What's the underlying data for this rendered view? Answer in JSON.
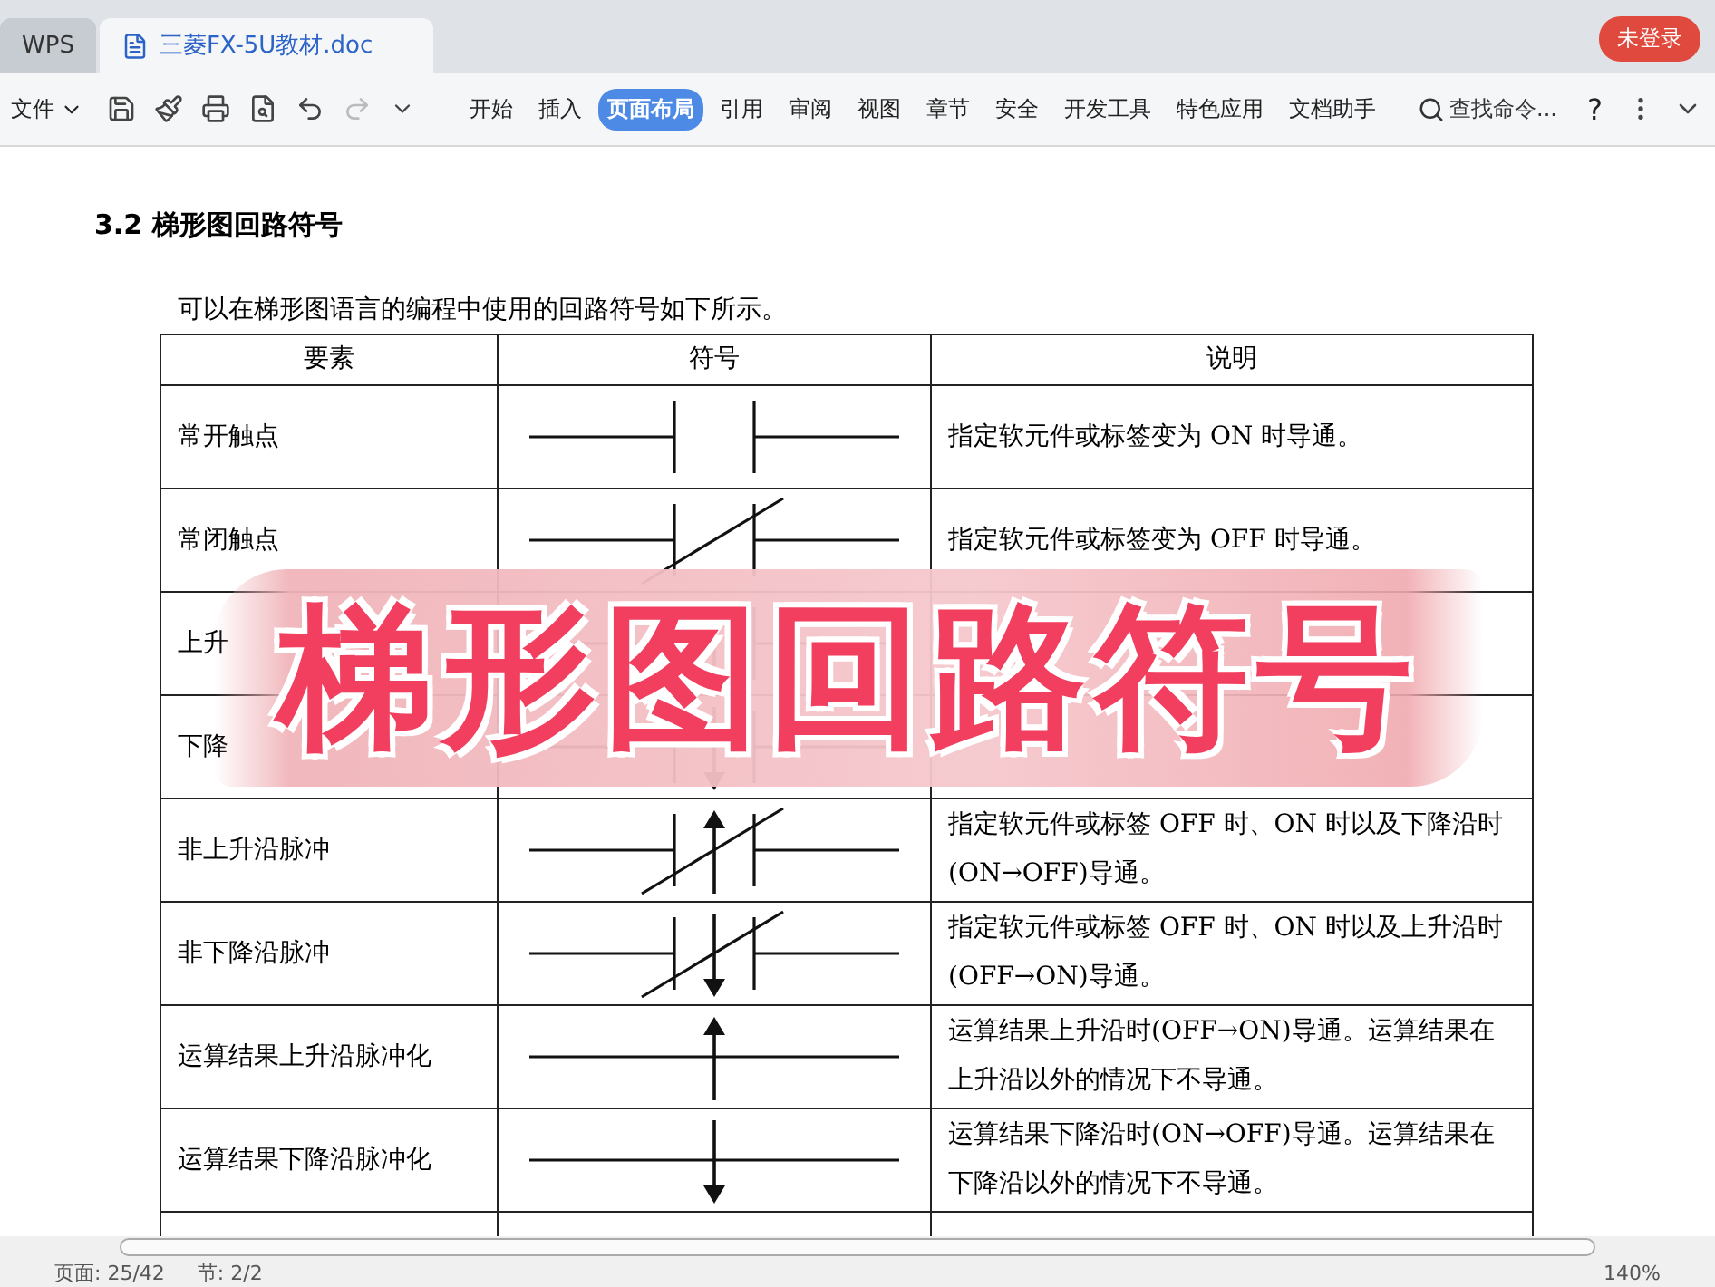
{
  "app_tabs": [
    {
      "label": "WPS",
      "selected": false
    },
    {
      "label": "三菱FX-5U教材.doc",
      "selected": true
    }
  ],
  "login_button": "未登录",
  "file_menu": "文件",
  "ribbon_tabs": [
    {
      "label": "开始",
      "selected": false
    },
    {
      "label": "插入",
      "selected": false
    },
    {
      "label": "页面布局",
      "selected": true
    },
    {
      "label": "引用",
      "selected": false
    },
    {
      "label": "审阅",
      "selected": false
    },
    {
      "label": "视图",
      "selected": false
    },
    {
      "label": "章节",
      "selected": false
    },
    {
      "label": "安全",
      "selected": false
    },
    {
      "label": "开发工具",
      "selected": false
    },
    {
      "label": "特色应用",
      "selected": false
    },
    {
      "label": "文档助手",
      "selected": false
    }
  ],
  "search": {
    "placeholder": "查找命令..."
  },
  "help": "?",
  "document": {
    "heading": "3.2  梯形图回路符号",
    "intro": "可以在梯形图语言的编程中使用的回路符号如下所示。",
    "table": {
      "columns": [
        "要素",
        "符号",
        "说明"
      ],
      "rows": [
        {
          "element": "常开触点",
          "kind": "no",
          "description": "指定软元件或标签变为 ON 时导通。"
        },
        {
          "element": "常闭触点",
          "kind": "nc",
          "description": "指定软元件或标签变为 OFF 时导通。"
        },
        {
          "element": "上升",
          "kind": "rise"
        },
        {
          "element": "下降",
          "kind": "fall"
        },
        {
          "element": "非上升沿脉冲",
          "kind": "not_rise",
          "description": "指定软元件或标签 OFF 时、ON 时以及下降沿时(ON→OFF)导通。"
        },
        {
          "element": "非下降沿脉冲",
          "kind": "not_fall",
          "description": "指定软元件或标签 OFF 时、ON 时以及上升沿时(OFF→ON)导通。"
        },
        {
          "element": "运算结果上升沿脉冲化",
          "kind": "op_rise",
          "description": "运算结果上升沿时(OFF→ON)导通。运算结果在上升沿以外的情况下不导通。"
        },
        {
          "element": "运算结果下降沿脉冲化",
          "kind": "op_fall",
          "description": "运算结果下降沿时(ON→OFF)导通。运算结果在下降沿以外的情况下不导通。"
        }
      ]
    },
    "banner": "梯形图回路符号"
  },
  "status_bar": {
    "page": "页面: 25/42",
    "section": "节: 2/2",
    "zoom": "140%"
  }
}
